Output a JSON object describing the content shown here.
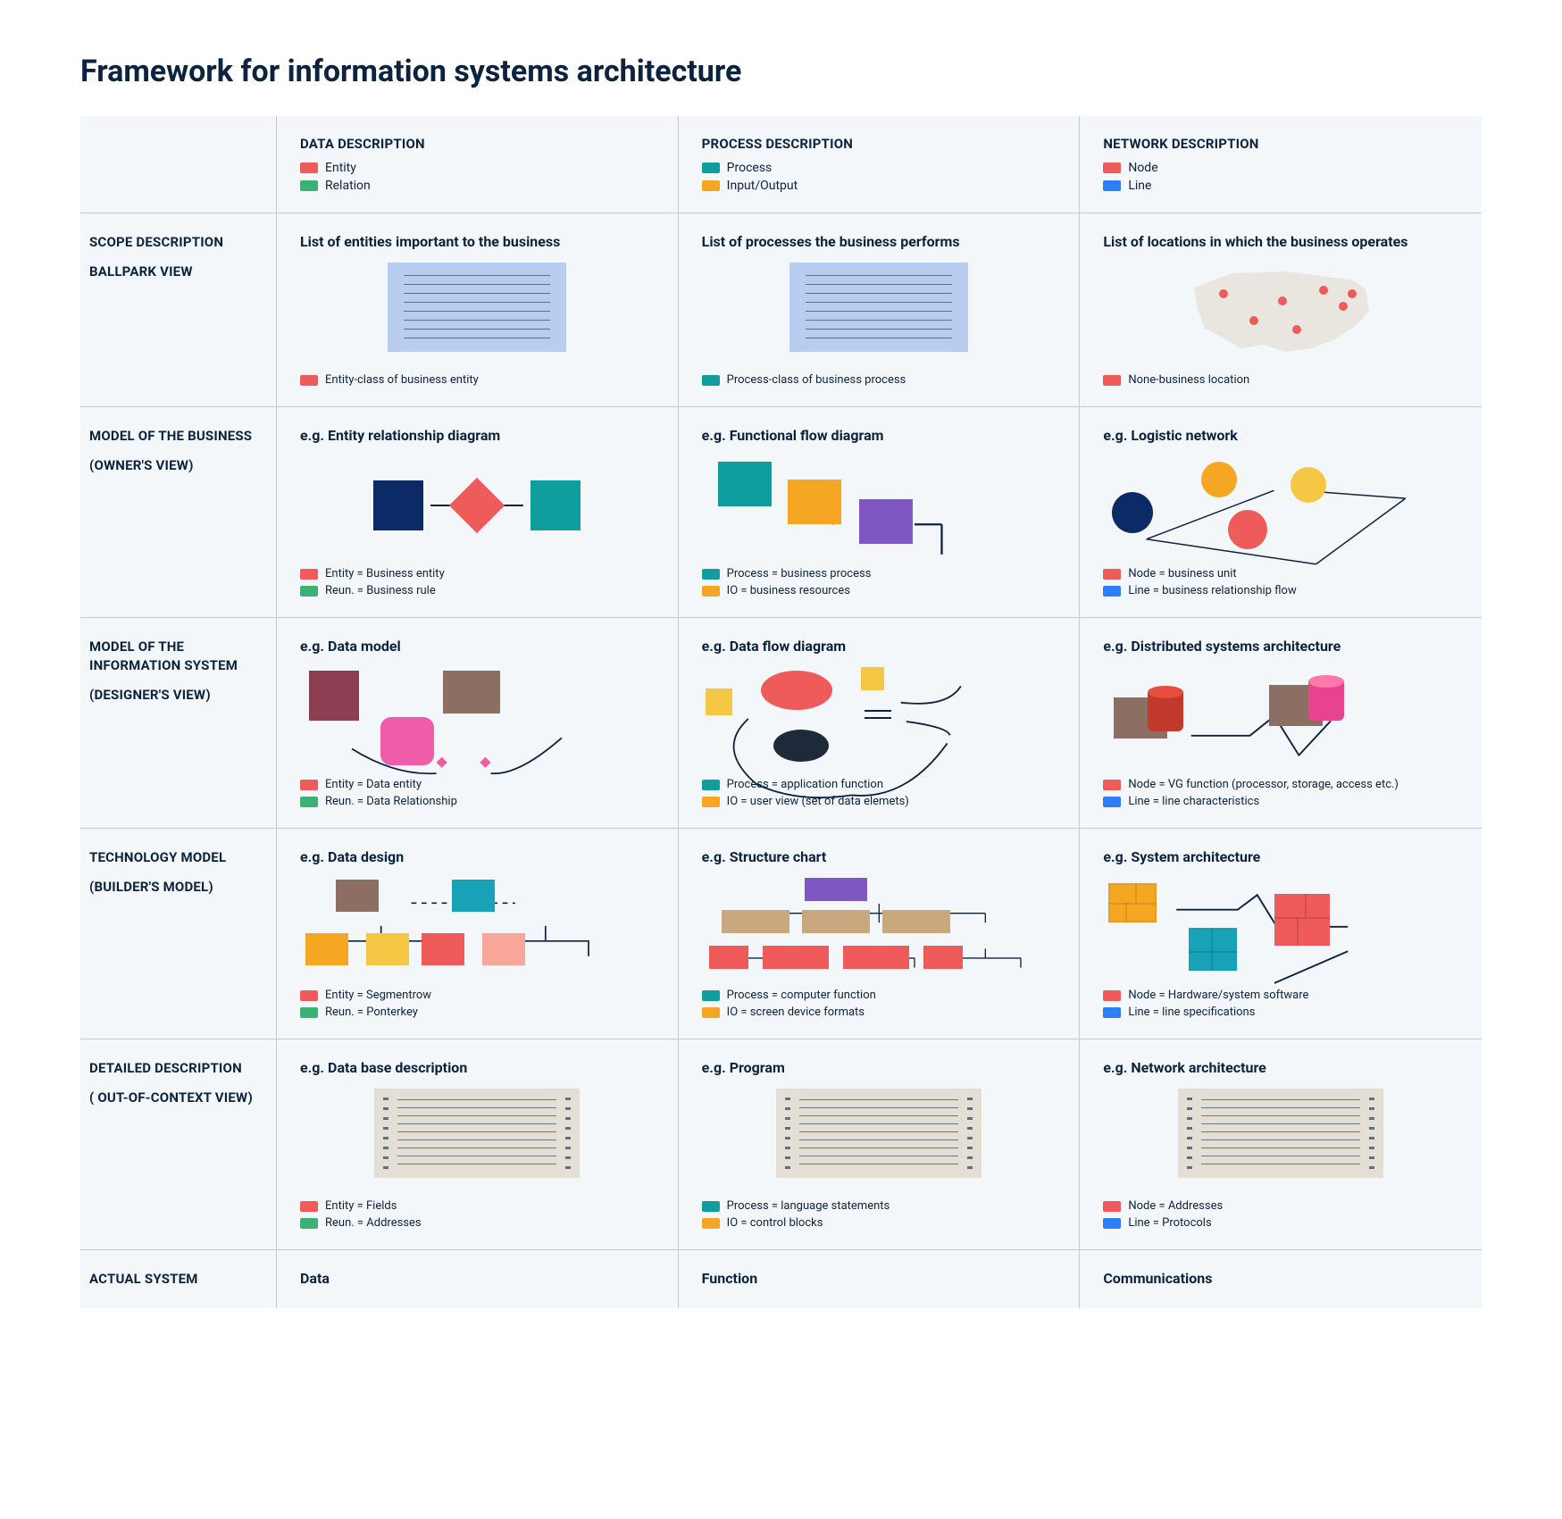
{
  "title": "Framework for information systems architecture",
  "columns": {
    "data": {
      "title": "DATA DESCRIPTION",
      "legend": [
        {
          "color": "red",
          "label": "Entity"
        },
        {
          "color": "green",
          "label": "Relation"
        }
      ]
    },
    "process": {
      "title": "PROCESS DESCRIPTION",
      "legend": [
        {
          "color": "teal",
          "label": "Process"
        },
        {
          "color": "orange",
          "label": "Input/Output"
        }
      ]
    },
    "network": {
      "title": "NETWORK DESCRIPTION",
      "legend": [
        {
          "color": "red",
          "label": "Node"
        },
        {
          "color": "blue",
          "label": "Line"
        }
      ]
    }
  },
  "rows": {
    "scope": {
      "label1": "SCOPE DESCRIPTION",
      "label2": "BALLPARK VIEW",
      "data": {
        "title": "List of entities important to the business",
        "legend": [
          {
            "color": "red",
            "label": "Entity-class of business entity"
          }
        ]
      },
      "process": {
        "title": "List of processes the business performs",
        "legend": [
          {
            "color": "teal",
            "label": "Process-class of business process"
          }
        ]
      },
      "network": {
        "title": "List of locations in which the business operates",
        "legend": [
          {
            "color": "red",
            "label": "None-business location"
          }
        ]
      }
    },
    "owner": {
      "label1": "MODEL OF THE BUSINESS",
      "label2": "(OWNER'S VIEW)",
      "data": {
        "title": "e.g. Entity relationship diagram",
        "legend": [
          {
            "color": "red",
            "label": "Entity = Business entity"
          },
          {
            "color": "green",
            "label": "Reun. = Business rule"
          }
        ]
      },
      "process": {
        "title": "e.g. Functional flow diagram",
        "legend": [
          {
            "color": "teal",
            "label": "Process = business process"
          },
          {
            "color": "orange",
            "label": "IO = business resources"
          }
        ]
      },
      "network": {
        "title": "e.g. Logistic network",
        "legend": [
          {
            "color": "red",
            "label": "Node = business unit"
          },
          {
            "color": "blue",
            "label": "Line = business relationship flow"
          }
        ]
      }
    },
    "designer": {
      "label1": "MODEL OF THE INFORMATION SYSTEM",
      "label2": "(DESIGNER'S VIEW)",
      "data": {
        "title": "e.g. Data model",
        "legend": [
          {
            "color": "red",
            "label": "Entity = Data entity"
          },
          {
            "color": "green",
            "label": "Reun. = Data Relationship"
          }
        ]
      },
      "process": {
        "title": "e.g. Data flow diagram",
        "legend": [
          {
            "color": "teal",
            "label": "Process = application function"
          },
          {
            "color": "orange",
            "label": "IO = user view (set of data elemets)"
          }
        ]
      },
      "network": {
        "title": "e.g. Distributed systems architecture",
        "legend": [
          {
            "color": "red",
            "label": "Node = VG function (processor, storage, access etc.)"
          },
          {
            "color": "blue",
            "label": "Line = line characteristics"
          }
        ]
      }
    },
    "builder": {
      "label1": "TECHNOLOGY MODEL",
      "label2": "(BUILDER'S MODEL)",
      "data": {
        "title": "e.g. Data design",
        "legend": [
          {
            "color": "red",
            "label": "Entity = Segmentrow"
          },
          {
            "color": "green",
            "label": "Reun. = Ponterkey"
          }
        ]
      },
      "process": {
        "title": "e.g. Structure chart",
        "legend": [
          {
            "color": "teal",
            "label": "Process = computer function"
          },
          {
            "color": "orange",
            "label": "IO = screen device formats"
          }
        ]
      },
      "network": {
        "title": "e.g. System architecture",
        "legend": [
          {
            "color": "red",
            "label": "Node = Hardware/system software"
          },
          {
            "color": "blue",
            "label": "Line = line specifications"
          }
        ]
      }
    },
    "detailed": {
      "label1": "DETAILED DESCRIPTION",
      "label2": "( OUT-OF-CONTEXT VIEW)",
      "data": {
        "title": "e.g. Data base description",
        "legend": [
          {
            "color": "red",
            "label": "Entity = Fields"
          },
          {
            "color": "green",
            "label": "Reun. = Addresses"
          }
        ]
      },
      "process": {
        "title": "e.g. Program",
        "legend": [
          {
            "color": "teal",
            "label": "Process = language statements"
          },
          {
            "color": "orange",
            "label": "IO = control blocks"
          }
        ]
      },
      "network": {
        "title": "e.g. Network architecture",
        "legend": [
          {
            "color": "red",
            "label": "Node = Addresses"
          },
          {
            "color": "blue",
            "label": "Line = Protocols"
          }
        ]
      }
    },
    "actual": {
      "label1": "ACTUAL SYSTEM",
      "data": {
        "title": "Data"
      },
      "process": {
        "title": "Function"
      },
      "network": {
        "title": "Communications"
      }
    }
  }
}
